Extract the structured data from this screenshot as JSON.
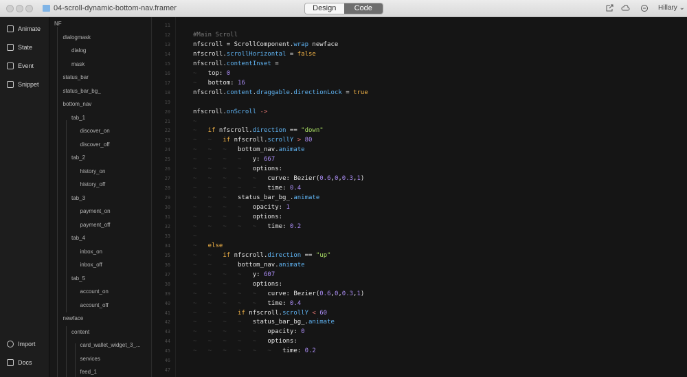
{
  "window": {
    "title": "04-scroll-dynamic-bottom-nav.framer",
    "mode_design": "Design",
    "mode_code": "Code",
    "user": "Hillary"
  },
  "rail": {
    "items": [
      {
        "label": "Animate",
        "icon": "animate-icon"
      },
      {
        "label": "State",
        "icon": "state-icon"
      },
      {
        "label": "Event",
        "icon": "event-icon"
      },
      {
        "label": "Snippet",
        "icon": "snippet-icon"
      }
    ],
    "bottom": [
      {
        "label": "Import",
        "icon": "import-icon"
      },
      {
        "label": "Docs",
        "icon": "docs-icon"
      }
    ]
  },
  "layers": [
    {
      "name": "NF",
      "depth": 0
    },
    {
      "name": "dialogmask",
      "depth": 1
    },
    {
      "name": "dialog",
      "depth": 2
    },
    {
      "name": "mask",
      "depth": 2
    },
    {
      "name": "status_bar",
      "depth": 1
    },
    {
      "name": "status_bar_bg_",
      "depth": 1
    },
    {
      "name": "bottom_nav",
      "depth": 1
    },
    {
      "name": "tab_1",
      "depth": 2
    },
    {
      "name": "discover_on",
      "depth": 3
    },
    {
      "name": "discover_off",
      "depth": 3
    },
    {
      "name": "tab_2",
      "depth": 2
    },
    {
      "name": "history_on",
      "depth": 3
    },
    {
      "name": "history_off",
      "depth": 3
    },
    {
      "name": "tab_3",
      "depth": 2
    },
    {
      "name": "payment_on",
      "depth": 3
    },
    {
      "name": "payment_off",
      "depth": 3
    },
    {
      "name": "tab_4",
      "depth": 2
    },
    {
      "name": "inbox_on",
      "depth": 3
    },
    {
      "name": "inbox_off",
      "depth": 3
    },
    {
      "name": "tab_5",
      "depth": 2
    },
    {
      "name": "account_on",
      "depth": 3
    },
    {
      "name": "account_off",
      "depth": 3
    },
    {
      "name": "newface",
      "depth": 1
    },
    {
      "name": "content",
      "depth": 2
    },
    {
      "name": "card_wallet_widget_3_...",
      "depth": 3
    },
    {
      "name": "services",
      "depth": 3
    },
    {
      "name": "feed_1",
      "depth": 3
    }
  ],
  "code": [
    {
      "n": "11",
      "ind": 0,
      "t": []
    },
    {
      "n": "12",
      "ind": 0,
      "t": [
        [
          "#Main Scroll",
          "comment"
        ]
      ]
    },
    {
      "n": "13",
      "ind": 0,
      "t": [
        [
          "nfscroll = ScrollComponent.",
          "plain"
        ],
        [
          "wrap",
          "prop"
        ],
        [
          " newface",
          "plain"
        ]
      ]
    },
    {
      "n": "14",
      "ind": 0,
      "t": [
        [
          "nfscroll.",
          "plain"
        ],
        [
          "scrollHorizontal",
          "prop"
        ],
        [
          " = ",
          "plain"
        ],
        [
          "false",
          "kw"
        ]
      ]
    },
    {
      "n": "15",
      "ind": 0,
      "t": [
        [
          "nfscroll.",
          "plain"
        ],
        [
          "contentInset",
          "prop"
        ],
        [
          " =",
          "plain"
        ]
      ]
    },
    {
      "n": "16",
      "ind": 1,
      "t": [
        [
          "top: ",
          "plain"
        ],
        [
          "0",
          "num"
        ]
      ]
    },
    {
      "n": "17",
      "ind": 1,
      "t": [
        [
          "bottom: ",
          "plain"
        ],
        [
          "16",
          "num"
        ]
      ]
    },
    {
      "n": "18",
      "ind": 0,
      "t": [
        [
          "nfscroll.",
          "plain"
        ],
        [
          "content",
          "prop"
        ],
        [
          ".",
          "plain"
        ],
        [
          "draggable",
          "prop"
        ],
        [
          ".",
          "plain"
        ],
        [
          "directionLock",
          "prop"
        ],
        [
          " = ",
          "plain"
        ],
        [
          "true",
          "kw"
        ]
      ]
    },
    {
      "n": "19",
      "ind": 0,
      "t": []
    },
    {
      "n": "20",
      "ind": 0,
      "t": [
        [
          "nfscroll.",
          "plain"
        ],
        [
          "onScroll",
          "prop"
        ],
        [
          " ->",
          "op"
        ]
      ]
    },
    {
      "n": "21",
      "ind": 1,
      "t": []
    },
    {
      "n": "22",
      "ind": 1,
      "t": [
        [
          "if",
          "kw"
        ],
        [
          " nfscroll.",
          "plain"
        ],
        [
          "direction",
          "prop"
        ],
        [
          " == ",
          "plain"
        ],
        [
          "\"down\"",
          "str"
        ]
      ]
    },
    {
      "n": "23",
      "ind": 2,
      "t": [
        [
          "if",
          "kw"
        ],
        [
          " nfscroll.",
          "plain"
        ],
        [
          "scrollY",
          "prop"
        ],
        [
          " > ",
          "op"
        ],
        [
          "80",
          "num"
        ]
      ]
    },
    {
      "n": "24",
      "ind": 3,
      "t": [
        [
          "bottom_nav.",
          "plain"
        ],
        [
          "animate",
          "prop"
        ]
      ]
    },
    {
      "n": "25",
      "ind": 4,
      "t": [
        [
          "y: ",
          "plain"
        ],
        [
          "667",
          "num"
        ]
      ]
    },
    {
      "n": "26",
      "ind": 4,
      "t": [
        [
          "options:",
          "plain"
        ]
      ]
    },
    {
      "n": "27",
      "ind": 5,
      "t": [
        [
          "curve: Bezier(",
          "plain"
        ],
        [
          "0.6",
          "num"
        ],
        [
          ",",
          "plain"
        ],
        [
          "0",
          "num"
        ],
        [
          ",",
          "plain"
        ],
        [
          "0.3",
          "num"
        ],
        [
          ",",
          "plain"
        ],
        [
          "1",
          "num"
        ],
        [
          ")",
          "plain"
        ]
      ]
    },
    {
      "n": "28",
      "ind": 5,
      "t": [
        [
          "time: ",
          "plain"
        ],
        [
          "0.4",
          "num"
        ]
      ]
    },
    {
      "n": "29",
      "ind": 3,
      "t": [
        [
          "status_bar_bg_.",
          "plain"
        ],
        [
          "animate",
          "prop"
        ]
      ]
    },
    {
      "n": "30",
      "ind": 4,
      "t": [
        [
          "opacity: ",
          "plain"
        ],
        [
          "1",
          "num"
        ]
      ]
    },
    {
      "n": "31",
      "ind": 4,
      "t": [
        [
          "options:",
          "plain"
        ]
      ]
    },
    {
      "n": "32",
      "ind": 5,
      "t": [
        [
          "time: ",
          "plain"
        ],
        [
          "0.2",
          "num"
        ]
      ]
    },
    {
      "n": "33",
      "ind": 1,
      "t": []
    },
    {
      "n": "34",
      "ind": 1,
      "t": [
        [
          "else",
          "kw"
        ]
      ]
    },
    {
      "n": "35",
      "ind": 2,
      "t": [
        [
          "if",
          "kw"
        ],
        [
          " nfscroll.",
          "plain"
        ],
        [
          "direction",
          "prop"
        ],
        [
          " == ",
          "plain"
        ],
        [
          "\"up\"",
          "str"
        ]
      ]
    },
    {
      "n": "36",
      "ind": 3,
      "t": [
        [
          "bottom_nav.",
          "plain"
        ],
        [
          "animate",
          "prop"
        ]
      ]
    },
    {
      "n": "37",
      "ind": 4,
      "t": [
        [
          "y: ",
          "plain"
        ],
        [
          "607",
          "num"
        ]
      ]
    },
    {
      "n": "38",
      "ind": 4,
      "t": [
        [
          "options:",
          "plain"
        ]
      ]
    },
    {
      "n": "39",
      "ind": 5,
      "t": [
        [
          "curve: Bezier(",
          "plain"
        ],
        [
          "0.6",
          "num"
        ],
        [
          ",",
          "plain"
        ],
        [
          "0",
          "num"
        ],
        [
          ",",
          "plain"
        ],
        [
          "0.3",
          "num"
        ],
        [
          ",",
          "plain"
        ],
        [
          "1",
          "num"
        ],
        [
          ")",
          "plain"
        ]
      ]
    },
    {
      "n": "40",
      "ind": 5,
      "t": [
        [
          "time: ",
          "plain"
        ],
        [
          "0.4",
          "num"
        ]
      ]
    },
    {
      "n": "41",
      "ind": 3,
      "t": [
        [
          "if",
          "kw"
        ],
        [
          " nfscroll.",
          "plain"
        ],
        [
          "scrollY",
          "prop"
        ],
        [
          " < ",
          "op"
        ],
        [
          "60",
          "num"
        ]
      ]
    },
    {
      "n": "42",
      "ind": 4,
      "t": [
        [
          "status_bar_bg_.",
          "plain"
        ],
        [
          "animate",
          "prop"
        ]
      ]
    },
    {
      "n": "43",
      "ind": 5,
      "t": [
        [
          "opacity: ",
          "plain"
        ],
        [
          "0",
          "num"
        ]
      ]
    },
    {
      "n": "44",
      "ind": 5,
      "t": [
        [
          "options:",
          "plain"
        ]
      ]
    },
    {
      "n": "45",
      "ind": 6,
      "t": [
        [
          "time: ",
          "plain"
        ],
        [
          "0.2",
          "num"
        ]
      ]
    },
    {
      "n": "46",
      "ind": 0,
      "t": []
    },
    {
      "n": "47",
      "ind": 0,
      "t": []
    }
  ]
}
